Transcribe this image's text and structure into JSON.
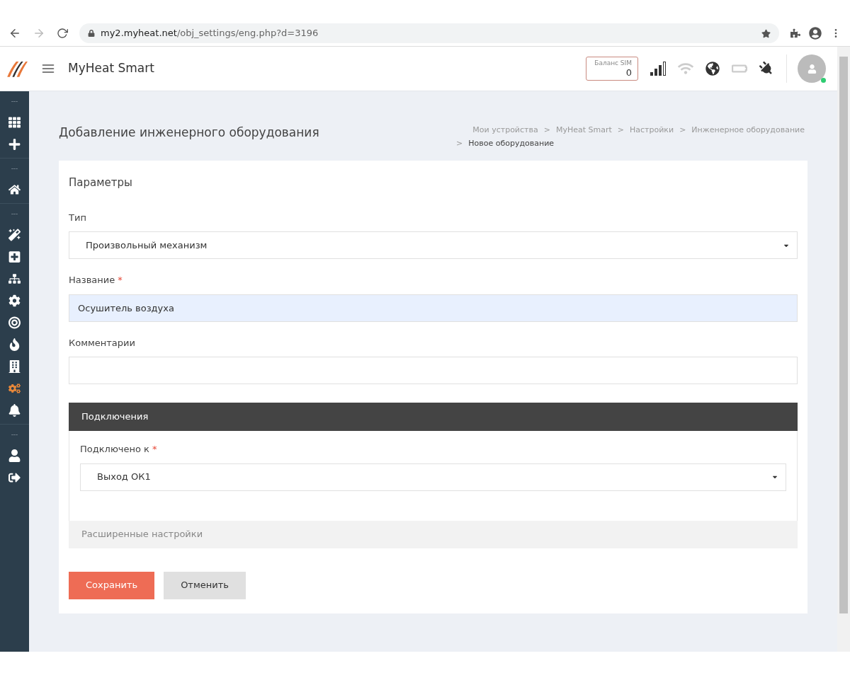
{
  "browser": {
    "url_host": "my2.myheat.net",
    "url_path": "/obj_settings/eng.php?d=3196"
  },
  "header": {
    "title": "MyHeat Smart",
    "sim": {
      "label": "Баланс SIM",
      "value": "0"
    },
    "online": true
  },
  "sidebar": {
    "groups": [
      {
        "label": "---",
        "items": [
          {
            "kind": "grid",
            "selected": false
          },
          {
            "kind": "plus",
            "selected": false
          }
        ]
      },
      {
        "label": "---",
        "items": [
          {
            "kind": "home",
            "selected": false
          }
        ]
      },
      {
        "label": "---",
        "items": [
          {
            "kind": "magic",
            "selected": false
          },
          {
            "kind": "plus-square",
            "selected": false
          },
          {
            "kind": "sitemap",
            "selected": false
          },
          {
            "kind": "cog",
            "selected": false
          },
          {
            "kind": "target",
            "selected": false
          },
          {
            "kind": "flame",
            "selected": false
          },
          {
            "kind": "building",
            "selected": false
          },
          {
            "kind": "cogs",
            "selected": true
          },
          {
            "kind": "bell",
            "selected": false
          }
        ]
      },
      {
        "label": "---",
        "items": [
          {
            "kind": "user",
            "selected": false
          },
          {
            "kind": "logout",
            "selected": false
          }
        ]
      }
    ]
  },
  "page": {
    "title": "Добавление инженерного оборудования",
    "breadcrumbs": [
      {
        "text": "Мои устройства"
      },
      {
        "separator": ">",
        "text": "MyHeat Smart"
      },
      {
        "separator": ">",
        "text": "Настройки"
      },
      {
        "separator": ">",
        "text": "Инженерное оборудование"
      },
      {
        "separator": ">",
        "text": "Новое оборудование"
      }
    ]
  },
  "form": {
    "section": "Параметры",
    "fields": [
      {
        "kind": "select",
        "label": "Тип",
        "value": "Произвольный механизм",
        "highlighted": false
      },
      {
        "kind": "input",
        "label": "Название",
        "required_mark": "*",
        "value": "Осушитель воздуха",
        "highlighted": true
      },
      {
        "kind": "input",
        "label": "Комментарии",
        "highlighted": false
      }
    ],
    "connections": {
      "title": "Подключения",
      "label": "Подключено к",
      "required_mark": "*",
      "value": "Выход ОК1"
    },
    "advanced": "Расширенные настройки",
    "buttons": [
      {
        "kind": "primary",
        "label": "Сохранить"
      },
      {
        "kind": "secondary",
        "label": "Отменить"
      }
    ]
  }
}
